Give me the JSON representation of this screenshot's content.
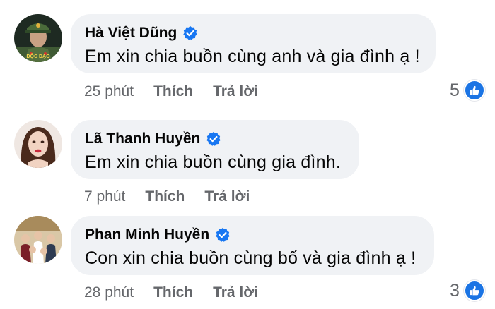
{
  "comments": [
    {
      "author": "Hà Việt Dũng",
      "verified": true,
      "text": "Em xin chia buồn cùng anh và gia đình ạ !",
      "time": "25 phút",
      "like_label": "Thích",
      "reply_label": "Trả lời",
      "reaction_count": "5",
      "avatar_icon": "avatar-police-uniform",
      "avatar_caption": "ĐỘC ĐẠO"
    },
    {
      "author": "Lã Thanh Huyền",
      "verified": true,
      "text": "Em xin chia buồn cùng gia đình.",
      "time": "7 phút",
      "like_label": "Thích",
      "reply_label": "Trả lời",
      "reaction_count": "",
      "avatar_icon": "avatar-woman-portrait"
    },
    {
      "author": "Phan Minh Huyền",
      "verified": true,
      "text": "Con xin chia buồn cùng bố và gia đình ạ !",
      "time": "28 phút",
      "like_label": "Thích",
      "reply_label": "Trả lời",
      "reaction_count": "3",
      "avatar_icon": "avatar-group-photo"
    }
  ],
  "colors": {
    "bubble_bg": "#f0f2f5",
    "meta_text": "#65676b",
    "verified_blue": "#1877f2",
    "like_blue": "#1b74e4"
  }
}
